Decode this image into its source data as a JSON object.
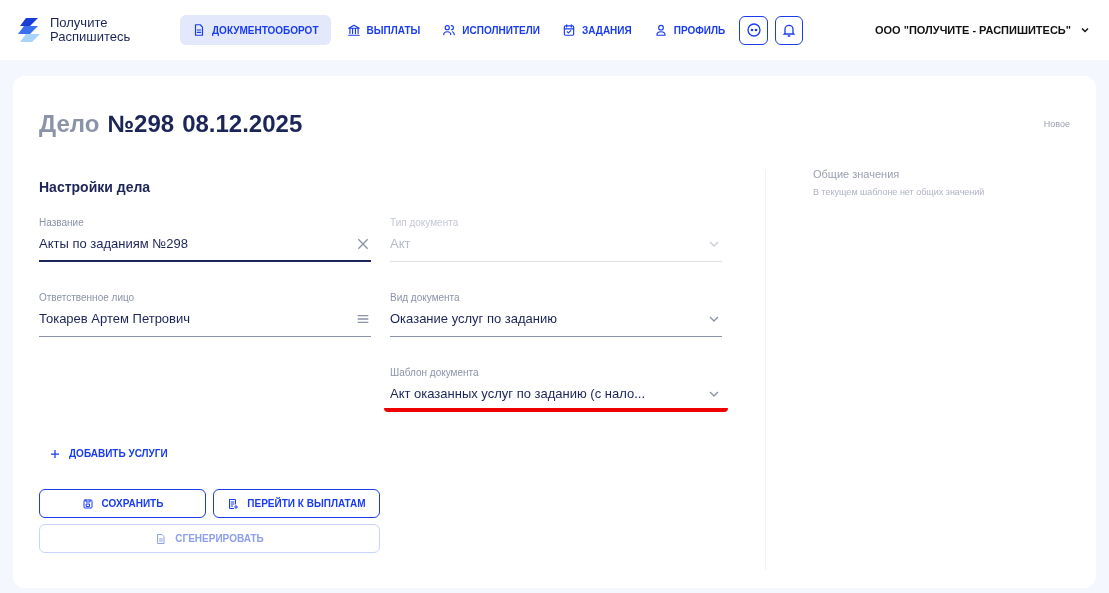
{
  "brand": {
    "line1": "Получите",
    "line2": "Распишитесь"
  },
  "nav": [
    {
      "label": "ДОКУМЕНТООБОРОТ",
      "selected": true
    },
    {
      "label": "ВЫПЛАТЫ",
      "selected": false
    },
    {
      "label": "ИСПОЛНИТЕЛИ",
      "selected": false
    },
    {
      "label": "ЗАДАНИЯ",
      "selected": false
    },
    {
      "label": "ПРОФИЛЬ",
      "selected": false
    }
  ],
  "company": "ООО \"ПОЛУЧИТЕ - РАСПИШИТЕСЬ\"",
  "title": {
    "prefix": "Дело",
    "number": "№298",
    "date": "08.12.2025"
  },
  "status": "Новое",
  "section_title": "Настройки дела",
  "fields": [
    {
      "label": "Название",
      "value": "Акты по заданиям №298",
      "kind": "text",
      "disabled": false,
      "error": false
    },
    {
      "label": "Тип документа",
      "value": "Акт",
      "kind": "select",
      "disabled": true,
      "error": false
    },
    {
      "label": "Ответственное лицо",
      "value": "Токарев Артем Петрович",
      "kind": "picker",
      "disabled": false,
      "error": false
    },
    {
      "label": "Вид документа",
      "value": "Оказание услуг по заданию",
      "kind": "select",
      "disabled": false,
      "error": false
    },
    {
      "label": "Шаблон документа",
      "value": "Акт оказанных услуг по заданию (с нало...",
      "kind": "select",
      "disabled": false,
      "error": true
    }
  ],
  "add_services": "ДОБАВИТЬ УСЛУГИ",
  "buttons": [
    {
      "label": "СОХРАНИТЬ",
      "disabled": false
    },
    {
      "label": "ПЕРЕЙТИ К ВЫПЛАТАМ",
      "disabled": false
    },
    {
      "label": "СГЕНЕРИРОВАТЬ",
      "disabled": true
    }
  ],
  "common": {
    "title": "Общие значения",
    "note": "В текущем шаблоне нет общих значений"
  }
}
